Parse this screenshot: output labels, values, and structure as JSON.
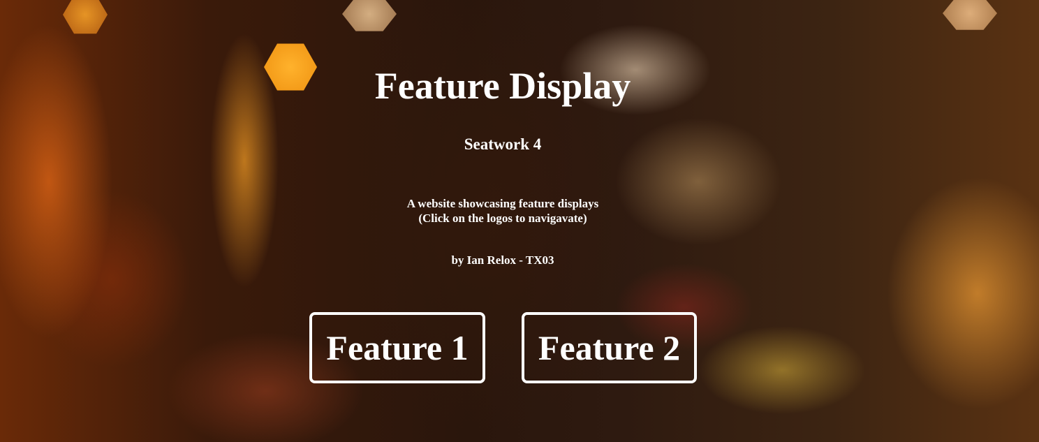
{
  "header": {
    "title": "Feature Display",
    "subtitle": "Seatwork 4"
  },
  "description": {
    "line1": "A website showcasing feature displays",
    "line2": "(Click on the logos to navigavate)"
  },
  "author": "by Ian Relox - TX03",
  "features": [
    {
      "label": "Feature 1"
    },
    {
      "label": "Feature 2"
    }
  ],
  "colors": {
    "text": "#ffffff",
    "button_border": "#ffffff",
    "background_base": "#2a1408",
    "bokeh_accent": "#f39a18"
  }
}
